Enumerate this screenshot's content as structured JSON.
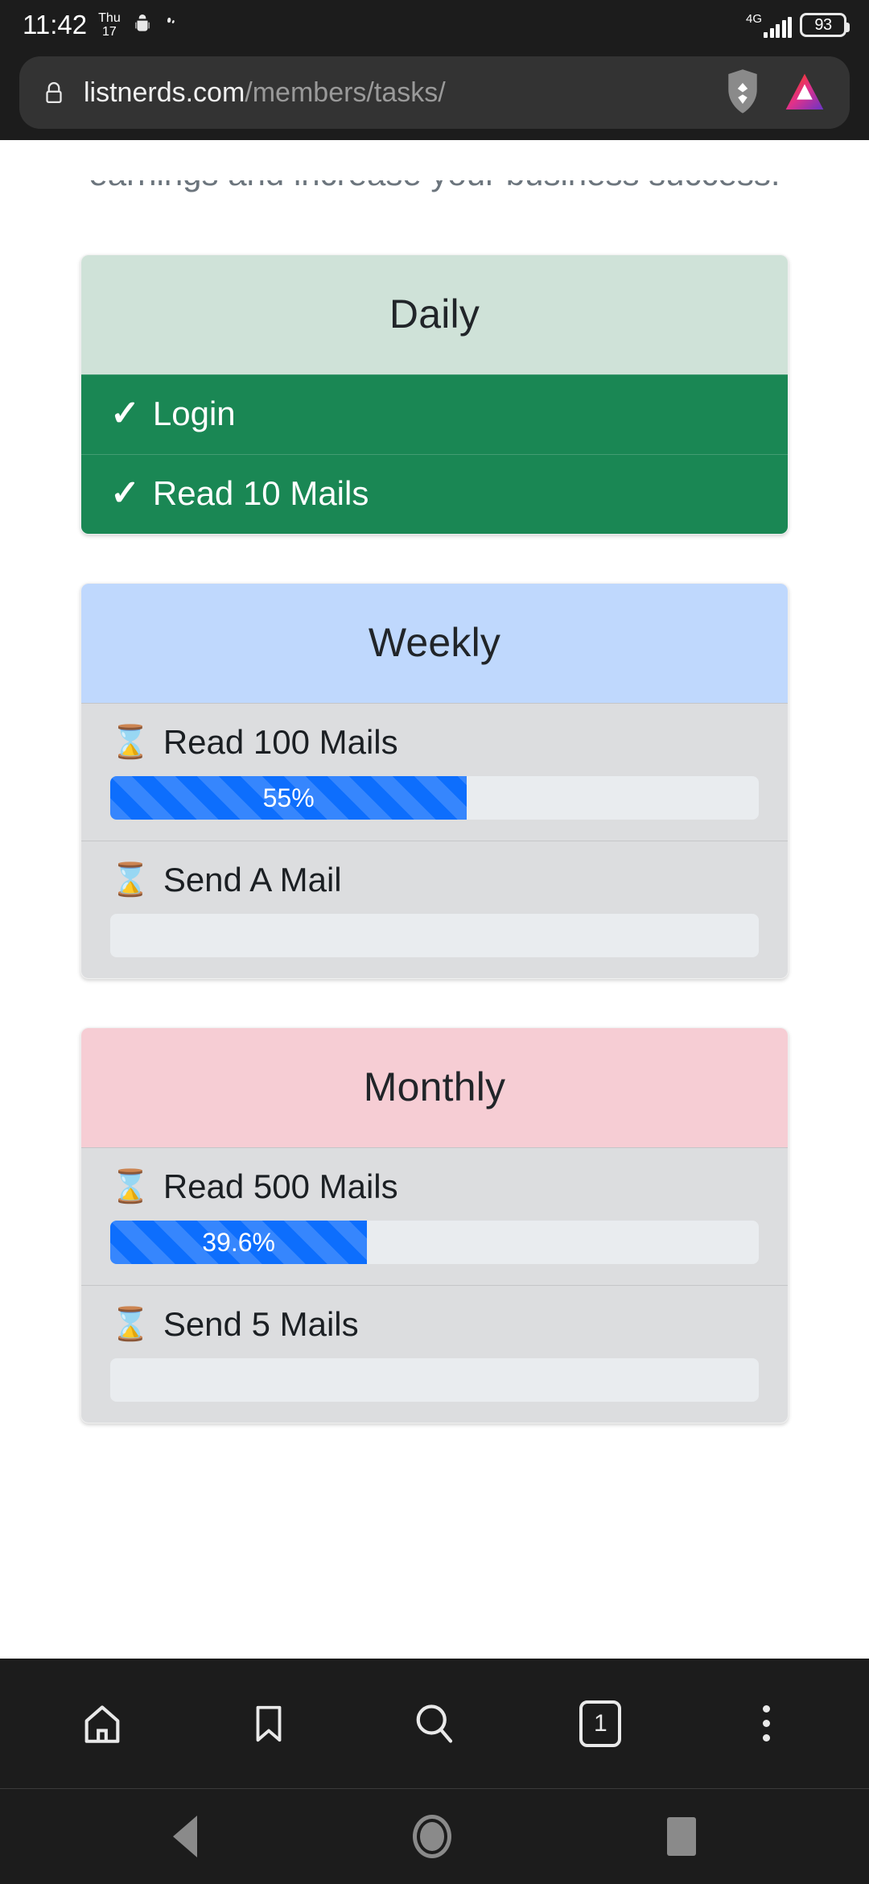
{
  "status_bar": {
    "time": "11:42",
    "date_day": "Thu",
    "date_num": "17",
    "network_type": "4G",
    "battery_level": "93",
    "icons": [
      "android-bug-icon",
      "footprint-icon",
      "signal-bars-icon",
      "battery-icon"
    ]
  },
  "url_bar": {
    "lock_icon": "lock-icon",
    "host": "listnerds.com",
    "path": "/members/tasks/",
    "shield_icon": "brave-shield-icon",
    "rewards_icon": "brave-rewards-triangle-icon"
  },
  "page": {
    "intro_text": "earnings and increase your business success.",
    "cards": [
      {
        "title": "Daily",
        "header_color": "#cfe2d8",
        "rows": [
          {
            "status": "done",
            "icon": "check-icon",
            "icon_glyph": "✓",
            "label": "Login",
            "progress": null
          },
          {
            "status": "done",
            "icon": "check-icon",
            "icon_glyph": "✓",
            "label": "Read 10 Mails",
            "progress": null
          }
        ]
      },
      {
        "title": "Weekly",
        "header_color": "#bfd8fd",
        "rows": [
          {
            "status": "pending",
            "icon": "hourglass-icon",
            "icon_glyph": "⌛",
            "label": "Read 100 Mails",
            "progress": {
              "percent": 55,
              "label": "55%"
            }
          },
          {
            "status": "pending",
            "icon": "hourglass-icon",
            "icon_glyph": "⌛",
            "label": "Send A Mail",
            "progress": {
              "percent": 0,
              "label": ""
            }
          }
        ]
      },
      {
        "title": "Monthly",
        "header_color": "#f6cdd4",
        "rows": [
          {
            "status": "pending",
            "icon": "hourglass-icon",
            "icon_glyph": "⌛",
            "label": "Read 500 Mails",
            "progress": {
              "percent": 39.6,
              "label": "39.6%"
            }
          },
          {
            "status": "pending",
            "icon": "hourglass-icon",
            "icon_glyph": "⌛",
            "label": "Send 5 Mails",
            "progress": {
              "percent": 0,
              "label": ""
            }
          }
        ]
      }
    ]
  },
  "browser_toolbar": {
    "items": [
      {
        "name": "home-icon",
        "label": ""
      },
      {
        "name": "bookmark-icon",
        "label": ""
      },
      {
        "name": "search-icon",
        "label": ""
      },
      {
        "name": "tab-switcher-icon",
        "label": "1"
      },
      {
        "name": "overflow-menu-icon",
        "label": ""
      }
    ]
  },
  "android_nav": {
    "back": "back-icon",
    "home": "home-circle-icon",
    "recents": "recents-icon"
  },
  "colors": {
    "progress_blue": "#0d6efd",
    "done_green": "#1a8754",
    "pending_gray": "#dcdddf",
    "chrome_dark": "#1c1c1c"
  }
}
